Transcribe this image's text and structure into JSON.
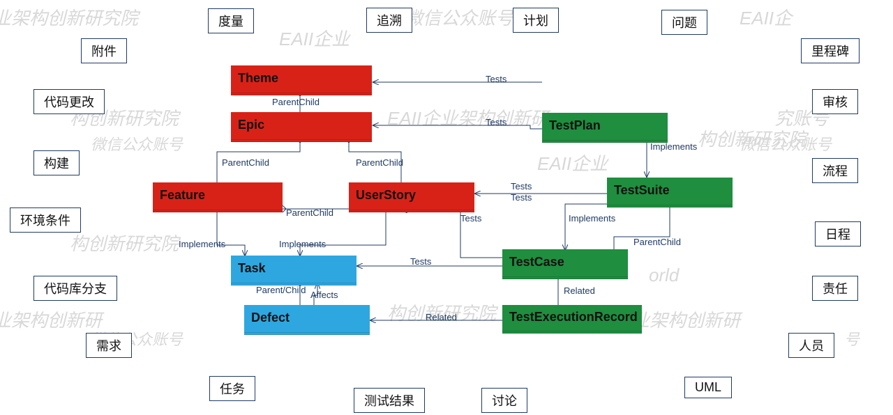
{
  "watermarks": [
    "业架构创新研究院",
    "EAII企业",
    "微信公众账号",
    "EAII企",
    "构创新研究院",
    "微信公众账号",
    "EAII企业架构创新研",
    "构创新研究院",
    "究账号",
    "微信公众账号",
    "EAII企业",
    "构创新研究院",
    "orld",
    "业架构创新研",
    "微信公众账号",
    "构创新研究院",
    "业架构创新研",
    "号"
  ],
  "tags": {
    "metric": "度量",
    "trace": "追溯",
    "plan": "计划",
    "issue": "问题",
    "milestone": "里程碑",
    "attachment": "附件",
    "codechange": "代码更改",
    "review": "审核",
    "build": "构建",
    "process": "流程",
    "envcond": "环境条件",
    "schedule": "日程",
    "branch": "代码库分支",
    "responsibility": "责任",
    "requirement": "需求",
    "people": "人员",
    "task_cn": "任务",
    "testresult": "测试结果",
    "discuss": "讨论",
    "uml": "UML"
  },
  "entities": {
    "theme": "Theme",
    "epic": "Epic",
    "feature": "Feature",
    "userstory": "UserStory",
    "task": "Task",
    "defect": "Defect",
    "testplan": "TestPlan",
    "testsuite": "TestSuite",
    "testcase": "TestCase",
    "ter": "TestExecutionRecord"
  },
  "edges": {
    "parentchild": "ParentChild",
    "parent_slash_child": "Parent/Child",
    "implements": "Implements",
    "tests": "Tests",
    "related": "Related",
    "affects": "Affects"
  }
}
